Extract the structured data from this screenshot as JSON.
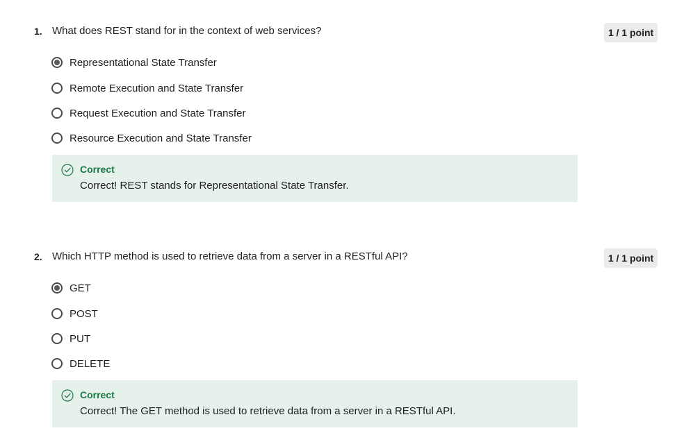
{
  "questions": [
    {
      "number": "1.",
      "text": "What does REST stand for in the context of web services?",
      "points": "1 / 1 point",
      "options": [
        {
          "label": "Representational State Transfer",
          "selected": true
        },
        {
          "label": "Remote Execution and State Transfer",
          "selected": false
        },
        {
          "label": "Request Execution and State Transfer",
          "selected": false
        },
        {
          "label": "Resource Execution and State Transfer",
          "selected": false
        }
      ],
      "feedback": {
        "icon": "check-circle-icon",
        "title": "Correct",
        "text": "Correct! REST stands for Representational State Transfer."
      }
    },
    {
      "number": "2.",
      "text": "Which HTTP method is used to retrieve data from a server in a RESTful API?",
      "points": "1 / 1 point",
      "options": [
        {
          "label": "GET",
          "selected": true
        },
        {
          "label": "POST",
          "selected": false
        },
        {
          "label": "PUT",
          "selected": false
        },
        {
          "label": "DELETE",
          "selected": false
        }
      ],
      "feedback": {
        "icon": "check-circle-icon",
        "title": "Correct",
        "text": "Correct! The GET method is used to retrieve data from a server in a RESTful API."
      }
    }
  ],
  "colors": {
    "correct_green": "#1a7a45",
    "feedback_bg": "#e6f1ec",
    "badge_bg": "#ebebeb"
  }
}
